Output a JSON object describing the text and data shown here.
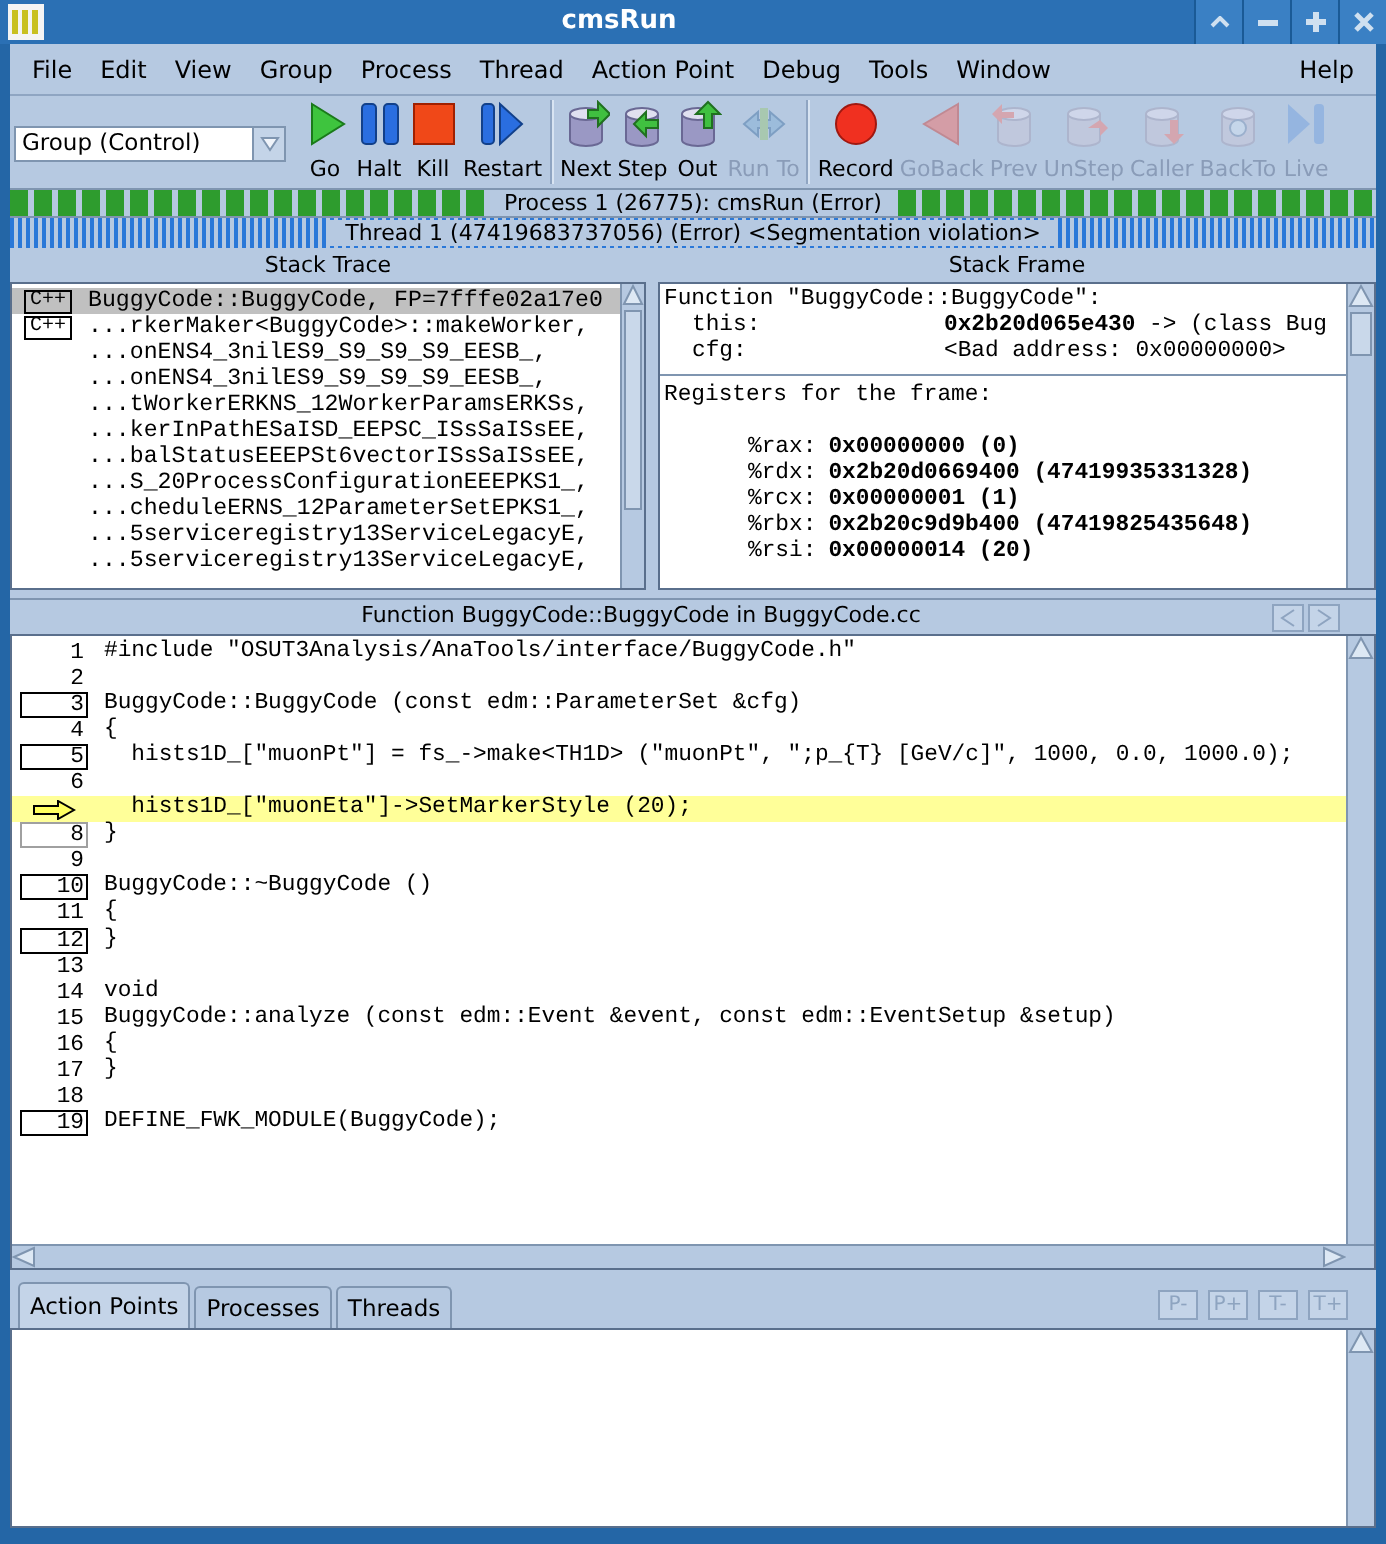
{
  "window": {
    "title": "cmsRun"
  },
  "menu": [
    "File",
    "Edit",
    "View",
    "Group",
    "Process",
    "Thread",
    "Action Point",
    "Debug",
    "Tools",
    "Window"
  ],
  "help_menu": "Help",
  "group_selector": {
    "value": "Group (Control)"
  },
  "toolbar": {
    "buttons": [
      {
        "label": "Go",
        "kind": "go",
        "disabled": false
      },
      {
        "label": "Halt",
        "kind": "halt",
        "disabled": false
      },
      {
        "label": "Kill",
        "kind": "kill",
        "disabled": false
      },
      {
        "label": "Restart",
        "kind": "restart",
        "disabled": false
      },
      {
        "label": "Next",
        "kind": "next",
        "disabled": false
      },
      {
        "label": "Step",
        "kind": "step",
        "disabled": false
      },
      {
        "label": "Out",
        "kind": "out",
        "disabled": false
      },
      {
        "label": "Run To",
        "kind": "runto",
        "disabled": true
      },
      {
        "label": "Record",
        "kind": "record",
        "disabled": false
      },
      {
        "label": "GoBack",
        "kind": "goback",
        "disabled": true
      },
      {
        "label": "Prev",
        "kind": "prev",
        "disabled": true
      },
      {
        "label": "UnStep",
        "kind": "unstep",
        "disabled": true
      },
      {
        "label": "Caller",
        "kind": "caller",
        "disabled": true
      },
      {
        "label": "BackTo",
        "kind": "backto",
        "disabled": true
      },
      {
        "label": "Live",
        "kind": "live",
        "disabled": true
      }
    ]
  },
  "process_status": "Process 1 (26775): cmsRun (Error)",
  "thread_status": "Thread 1 (47419683737056) (Error) <Segmentation violation>",
  "stack_trace": {
    "title": "Stack Trace",
    "rows": [
      {
        "language": "C++",
        "text": "BuggyCode::BuggyCode, FP=7fffe02a17e0",
        "selected": true
      },
      {
        "language": "C++",
        "text": "...rkerMaker<BuggyCode>::makeWorker,",
        "selected": false
      },
      {
        "text": "...onENS4_3nilES9_S9_S9_S9_EESB_,",
        "selected": false
      },
      {
        "text": "...onENS4_3nilES9_S9_S9_S9_EESB_,",
        "selected": false
      },
      {
        "text": "...tWorkerERKNS_12WorkerParamsERKSs,",
        "selected": false
      },
      {
        "text": "...kerInPathESaISD_EEPSC_ISsSaISsEE,",
        "selected": false
      },
      {
        "text": "...balStatusEEEPSt6vectorISsSaISsEE,",
        "selected": false
      },
      {
        "text": "...S_20ProcessConfigurationEEEPKS1_,",
        "selected": false
      },
      {
        "text": "...cheduleERNS_12ParameterSetEPKS1_,",
        "selected": false
      },
      {
        "text": "...5serviceregistry13ServiceLegacyE,",
        "selected": false
      },
      {
        "text": "...5serviceregistry13ServiceLegacyE,",
        "selected": false
      }
    ]
  },
  "stack_frame": {
    "title": "Stack Frame",
    "function": "Function \"BuggyCode::BuggyCode\":",
    "variables": [
      {
        "name": "this:",
        "value": "**0x2b20d065e430** -> (class Bug"
      },
      {
        "name": "cfg:",
        "value": "<Bad address: 0x00000000>"
      }
    ],
    "registers_heading": "Registers for the frame:",
    "registers": [
      {
        "name": "%rax:",
        "value": "0x00000000 (0)"
      },
      {
        "name": "%rdx:",
        "value": "0x2b20d0669400 (47419935331328)"
      },
      {
        "name": "%rcx:",
        "value": "0x00000001 (1)"
      },
      {
        "name": "%rbx:",
        "value": "0x2b20c9d9b400 (47419825435648)"
      },
      {
        "name": "%rsi:",
        "value": "0x00000014 (20)"
      }
    ]
  },
  "source": {
    "title": "Function BuggyCode::BuggyCode in BuggyCode.cc",
    "lines": [
      {
        "number": "1",
        "text": "#include \"OSUT3Analysis/AnaTools/interface/BuggyCode.h\"",
        "boxed": false,
        "current": false
      },
      {
        "number": "2",
        "boxed": false,
        "current": false
      },
      {
        "number": "3",
        "text": "BuggyCode::BuggyCode (const edm::ParameterSet &cfg)",
        "boxed": true,
        "current": false
      },
      {
        "number": "4",
        "text": "{",
        "boxed": false,
        "current": false
      },
      {
        "number": "5",
        "text": "  hists1D_[\"muonPt\"] = fs_->make<TH1D> (\"muonPt\", \";p_{T} [GeV/c]\", 1000, 0.0, 1000.0);",
        "boxed": true,
        "current": false
      },
      {
        "number": "6",
        "boxed": false,
        "current": false
      },
      {
        "text": "  hists1D_[\"muonEta\"]->SetMarkerStyle (20);",
        "boxed": false,
        "current": true
      },
      {
        "number": "8",
        "text": "}",
        "boxed": true,
        "dimmed": true,
        "current": false
      },
      {
        "number": "9",
        "boxed": false,
        "current": false
      },
      {
        "number": "10",
        "text": "BuggyCode::~BuggyCode ()",
        "boxed": true,
        "current": false
      },
      {
        "number": "11",
        "text": "{",
        "boxed": false,
        "current": false
      },
      {
        "number": "12",
        "text": "}",
        "boxed": true,
        "current": false
      },
      {
        "number": "13",
        "boxed": false,
        "current": false
      },
      {
        "number": "14",
        "text": "void",
        "boxed": false,
        "current": false
      },
      {
        "number": "15",
        "text": "BuggyCode::analyze (const edm::Event &event, const edm::EventSetup &setup)",
        "boxed": false,
        "current": false
      },
      {
        "number": "16",
        "text": "{",
        "boxed": false,
        "current": false
      },
      {
        "number": "17",
        "text": "}",
        "boxed": false,
        "current": false
      },
      {
        "number": "18",
        "boxed": false,
        "current": false
      },
      {
        "number": "19",
        "text": "DEFINE_FWK_MODULE(BuggyCode);",
        "boxed": true,
        "current": false
      }
    ]
  },
  "tabs": [
    {
      "label": "Action Points",
      "selected": true
    },
    {
      "label": "Processes",
      "selected": false
    },
    {
      "label": "Threads",
      "selected": false
    }
  ],
  "tab_buttons": [
    {
      "label": "P-",
      "disabled": true
    },
    {
      "label": "P+",
      "disabled": true
    },
    {
      "label": "T-",
      "disabled": true
    },
    {
      "label": "T+",
      "disabled": true
    }
  ]
}
